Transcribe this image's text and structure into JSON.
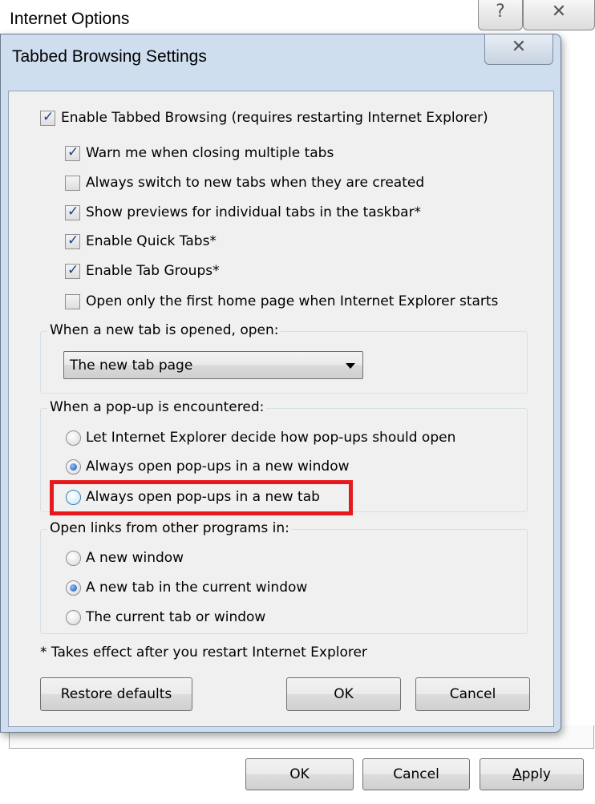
{
  "background_window": {
    "title": "Internet Options",
    "help_glyph": "?",
    "close_glyph": "✕",
    "buttons": {
      "ok": "OK",
      "cancel": "Cancel",
      "apply": "Apply",
      "apply_mnemonic": "A",
      "apply_rest": "pply"
    }
  },
  "dialog": {
    "title": "Tabbed Browsing Settings",
    "close_glyph": "✕",
    "enable_tabbed": {
      "label": "Enable Tabbed Browsing (requires restarting Internet Explorer)",
      "checked": true
    },
    "options": [
      {
        "label": "Warn me when closing multiple tabs",
        "checked": true
      },
      {
        "label": "Always switch to new tabs when they are created",
        "checked": false
      },
      {
        "label": "Show previews for individual tabs in the taskbar*",
        "checked": true
      },
      {
        "label": "Enable Quick Tabs*",
        "checked": true
      },
      {
        "label": "Enable Tab Groups*",
        "checked": true
      },
      {
        "label": "Open only the first home page when Internet Explorer starts",
        "checked": false
      }
    ],
    "new_tab_group": {
      "label": "When a new tab is opened, open:",
      "selected": "The new tab page"
    },
    "popup_group": {
      "label": "When a pop-up is encountered:",
      "options": [
        {
          "label": "Let Internet Explorer decide how pop-ups should open",
          "selected": false
        },
        {
          "label": "Always open pop-ups in a new window",
          "selected": true
        },
        {
          "label": "Always open pop-ups in a new tab",
          "selected": false
        }
      ]
    },
    "links_group": {
      "label": "Open links from other programs in:",
      "options": [
        {
          "label": "A new window",
          "selected": false
        },
        {
          "label": "A new tab in the current window",
          "selected": true
        },
        {
          "label": "The current tab or window",
          "selected": false
        }
      ]
    },
    "footnote": "* Takes effect after you restart Internet Explorer",
    "buttons": {
      "restore": "Restore defaults",
      "ok": "OK",
      "cancel": "Cancel"
    }
  },
  "colors": {
    "highlight": "#e8191c",
    "dialog_frame": "#cfdeef",
    "client_bg": "#f0f0f0"
  }
}
